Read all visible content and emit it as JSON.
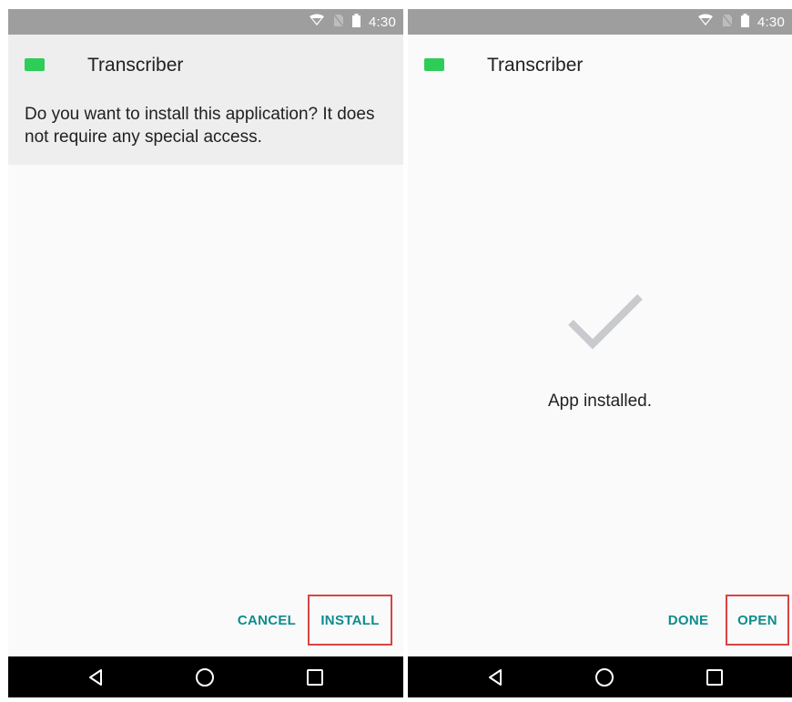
{
  "status_bar": {
    "time": "4:30"
  },
  "left_screen": {
    "app_name": "Transcriber",
    "prompt": "Do you want to install this application? It does not require any special access.",
    "cancel_label": "CANCEL",
    "install_label": "INSTALL"
  },
  "right_screen": {
    "app_name": "Transcriber",
    "installed_message": "App installed.",
    "done_label": "DONE",
    "open_label": "OPEN"
  },
  "colors": {
    "accent": "#0e8c8c",
    "highlight_box": "#d84444",
    "app_icon": "#2ecc58",
    "status_bar": "#9e9e9e",
    "nav_bar": "#000000"
  },
  "icons": [
    "wifi-icon",
    "no-sim-icon",
    "battery-icon",
    "checkmark-icon",
    "back-icon",
    "home-icon",
    "recents-icon"
  ]
}
